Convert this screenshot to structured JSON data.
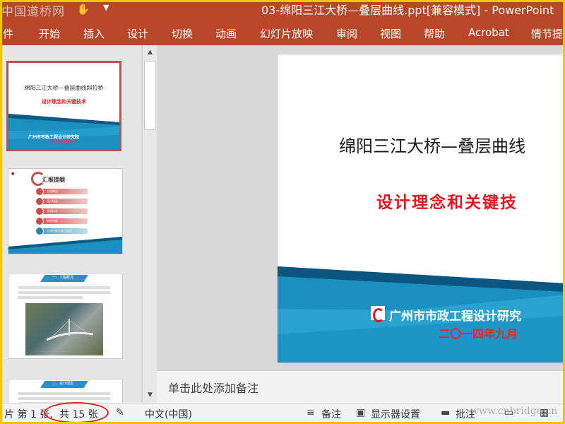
{
  "titlebar": {
    "watermark": "中国道桥网",
    "doc_title": "03-绵阳三江大桥—叠层曲线.ppt[兼容模式] - PowerPoint"
  },
  "menu": [
    "件",
    "开始",
    "插入",
    "设计",
    "切换",
    "动画",
    "幻灯片放映",
    "审阅",
    "视图",
    "帮助",
    "Acrobat",
    "情节提"
  ],
  "thumbnails": {
    "slide1": {
      "title": "绵阳三江大桥—叠层曲线斜拉桥",
      "subtitle": "设计理念和关键技术",
      "org": "广州市市政工程设计研究院",
      "date": "二〇一四年九月"
    },
    "slide2": {
      "heading": "汇报提纲",
      "items": [
        "工程概况",
        "设计理念",
        "关键技术",
        "科研创新",
        "几何控制与施工监控"
      ]
    },
    "slide3": {
      "heading": "一、工程概况"
    },
    "slide4": {
      "heading": "二、设计理念"
    }
  },
  "slide": {
    "title": "绵阳三江大桥—叠层曲线",
    "subtitle": "设计理念和关键技",
    "org": "广州市市政工程设计研究",
    "date": "二〇一四年九月"
  },
  "notes": {
    "placeholder": "单击此处添加备注"
  },
  "statusbar": {
    "slide_pos": "片 第 1 张,",
    "total": "共 15 张",
    "language": "中文(中国)",
    "notes_label": "备注",
    "display_label": "显示器设置",
    "comments_label": "批注",
    "watermark": "www.cnbridge.cn"
  },
  "colors": {
    "ribbon": "#b7472a",
    "accent_red": "#e8151b",
    "band_blue": "#1a8fc0"
  }
}
